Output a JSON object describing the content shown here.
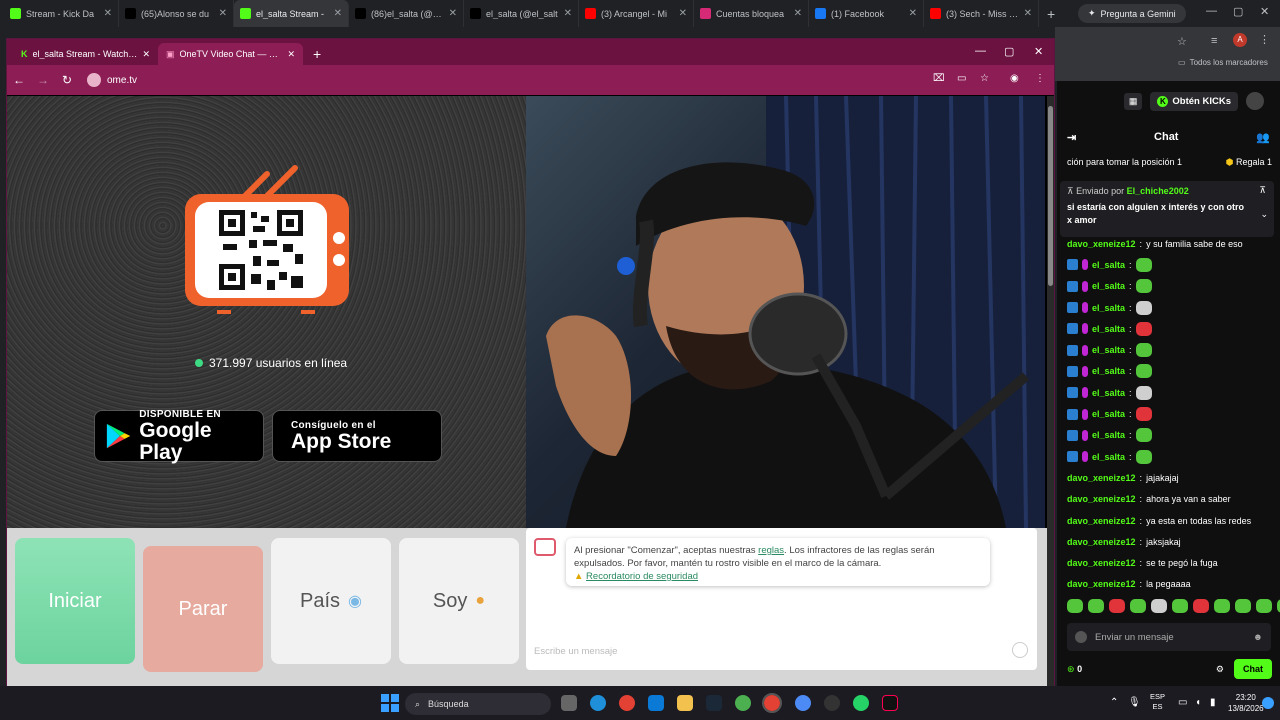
{
  "outer_browser": {
    "tabs": [
      {
        "label": "Stream - Kick Da",
        "favicon": "kick-icon",
        "color": "#53fc18"
      },
      {
        "label": "(65)Alonso se du",
        "favicon": "tiktok-icon",
        "color": "#000000"
      },
      {
        "label": "el_salta Stream -",
        "favicon": "kick-icon",
        "color": "#53fc18",
        "active": true
      },
      {
        "label": "(86)el_salta (@el_",
        "favicon": "tiktok-icon",
        "color": "#000000"
      },
      {
        "label": "el_salta (@el_salt",
        "favicon": "tiktok-icon",
        "color": "#000000"
      },
      {
        "label": "(3) Arcangel - Mi",
        "favicon": "youtube-icon",
        "color": "#ff0000"
      },
      {
        "label": "Cuentas bloquea",
        "favicon": "instagram-icon",
        "color": "#d62976"
      },
      {
        "label": "(1) Facebook",
        "favicon": "facebook-icon",
        "color": "#1877f2"
      },
      {
        "label": "(3) Sech - Miss Lo",
        "favicon": "youtube-icon",
        "color": "#ff0000"
      }
    ],
    "gemini_label": "Pregunta a Gemini",
    "bookmarks_label": "Todos los marcadores",
    "profile_initial": "A"
  },
  "inner_browser": {
    "tabs": [
      {
        "label": "el_salta Stream - Watch Live on",
        "favicon": "kick-icon"
      },
      {
        "label": "OneTV Video Chat — Ome",
        "favicon": "ometv-icon",
        "active": true
      }
    ],
    "url": "ome.tv"
  },
  "ometv": {
    "users_online": "371.997 usuarios en línea",
    "google_play": {
      "small": "DISPONIBLE EN",
      "big": "Google Play"
    },
    "app_store": {
      "small": "Consíguelo en el",
      "big": "App Store"
    },
    "buttons": {
      "start": "Iniciar",
      "stop": "Parar",
      "country": "País",
      "gender": "Soy"
    },
    "notice": {
      "text1": "Al presionar \"Comenzar\", aceptas nuestras ",
      "rules_link": "reglas",
      "text2": ". Los infractores de las reglas serán expulsados. Por favor, mantén tu rostro visible en el marco de la cámara.",
      "safety_link": "Recordatorio de seguridad"
    },
    "message_placeholder": "Escribe un mensaje"
  },
  "kick_chat": {
    "get_kicks": "Obtén KICKs",
    "title": "Chat",
    "position_text": "ción para tomar la posición 1",
    "gift_label": "Regala 1",
    "pinned": {
      "by_prefix": "Enviado por",
      "by_user": "El_chiche2002",
      "text": "si estaría con alguien x interés y con otro x amor"
    },
    "messages": [
      {
        "user": "davo_xeneize12",
        "text": "y su familia sabe de eso",
        "emote": ""
      },
      {
        "user": "el_salta",
        "text": "",
        "emote": "g",
        "badges": true
      },
      {
        "user": "el_salta",
        "text": "",
        "emote": "g",
        "badges": true
      },
      {
        "user": "el_salta",
        "text": "",
        "emote": "w",
        "badges": true
      },
      {
        "user": "el_salta",
        "text": "",
        "emote": "r",
        "badges": true
      },
      {
        "user": "el_salta",
        "text": "",
        "emote": "g",
        "badges": true
      },
      {
        "user": "el_salta",
        "text": "",
        "emote": "g",
        "badges": true
      },
      {
        "user": "el_salta",
        "text": "",
        "emote": "w",
        "badges": true
      },
      {
        "user": "el_salta",
        "text": "",
        "emote": "r",
        "badges": true
      },
      {
        "user": "el_salta",
        "text": "",
        "emote": "g",
        "badges": true
      },
      {
        "user": "el_salta",
        "text": "",
        "emote": "g",
        "badges": true
      },
      {
        "user": "davo_xeneize12",
        "text": "jajakajaj",
        "emote": ""
      },
      {
        "user": "davo_xeneize12",
        "text": "ahora ya van a saber",
        "emote": ""
      },
      {
        "user": "davo_xeneize12",
        "text": "ya esta en todas las redes",
        "emote": ""
      },
      {
        "user": "davo_xeneize12",
        "text": "jaksjakaj",
        "emote": ""
      },
      {
        "user": "davo_xeneize12",
        "text": "se te pegó la fuga",
        "emote": ""
      },
      {
        "user": "davo_xeneize12",
        "text": "la pegaaaa",
        "emote": ""
      }
    ],
    "send_placeholder": "Enviar un mensaje",
    "kicks_count": "0",
    "chat_button": "Chat"
  },
  "taskbar": {
    "search_label": "Búsqueda",
    "lang_top": "ESP",
    "lang_bottom": "ES",
    "time": "23:20",
    "date": "13/8/2026"
  }
}
